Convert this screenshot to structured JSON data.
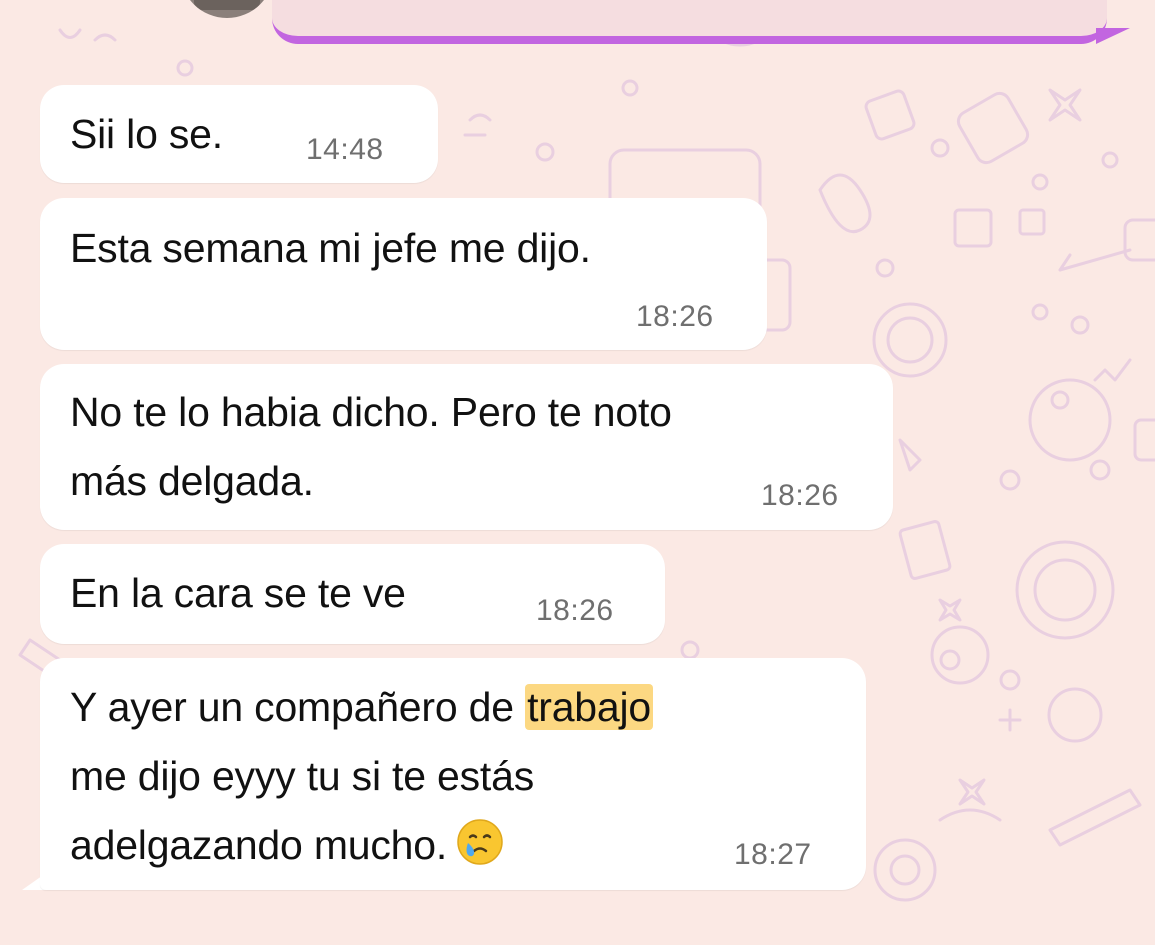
{
  "colors": {
    "background": "#fbe9e4",
    "bubble": "#ffffff",
    "outgoing_border": "#c265e0",
    "highlight": "#fcd882",
    "time_text": "#6f6f6f"
  },
  "messages": [
    {
      "text": "Sii lo se.",
      "time": "14:48"
    },
    {
      "text": "Esta semana mi jefe me dijo.",
      "time": "18:26"
    },
    {
      "lines": [
        "No te lo habia dicho. Pero te noto",
        "más delgada."
      ],
      "time": "18:26"
    },
    {
      "text": "En la cara se te ve",
      "time": "18:26"
    },
    {
      "line1_before": "Y ayer un compañero de ",
      "line1_highlight": "trabajo",
      "line2": "me dijo eyyy tu si te estás",
      "line3": "adelgazando mucho.",
      "emoji": "face-holding-back-tears",
      "time": "18:27"
    }
  ]
}
